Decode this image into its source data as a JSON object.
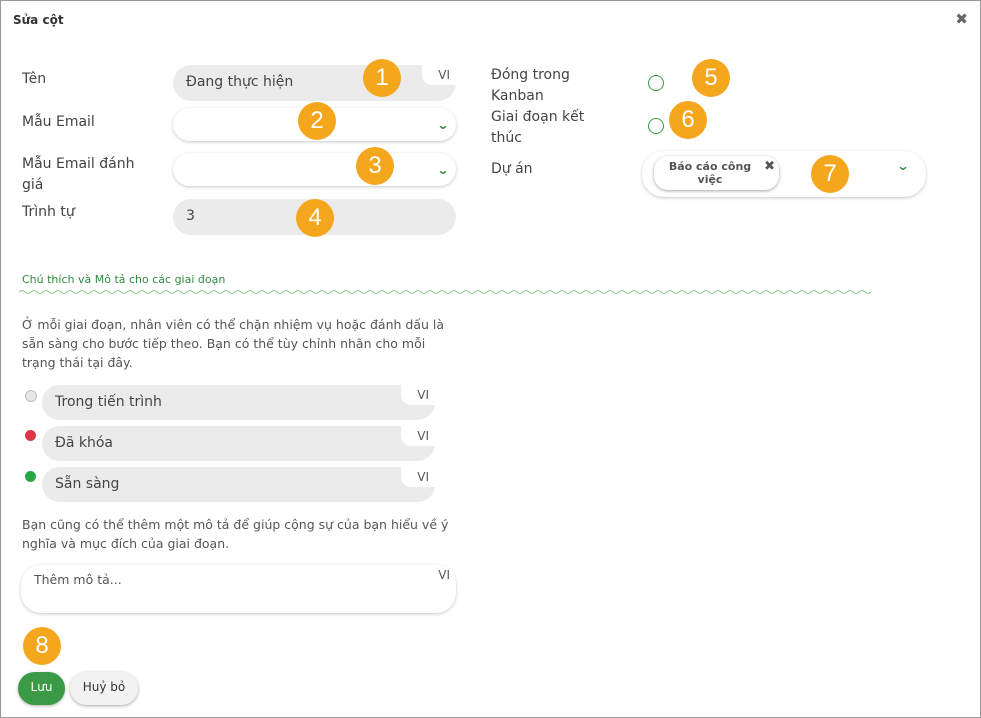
{
  "dialog": {
    "title": "Sửa cột",
    "close_glyph": "✖"
  },
  "form": {
    "name": {
      "label": "Tên",
      "value": "Đang thực hiện",
      "lang": "VI"
    },
    "email_template": {
      "label": "Mẫu Email",
      "value": ""
    },
    "rating_email_template": {
      "label": "Mẫu Email đánh giá",
      "value": ""
    },
    "sequence": {
      "label": "Trình tự",
      "value": "3"
    },
    "fold_in_kanban": {
      "label": "Đóng trong Kanban"
    },
    "final_stage": {
      "label": "Giai đoạn kết thúc"
    },
    "project": {
      "label": "Dự án",
      "tag": "Báo cáo công việc",
      "tag_remove": "✖"
    }
  },
  "badges": [
    "1",
    "2",
    "3",
    "4",
    "5",
    "6",
    "7",
    "8"
  ],
  "legend_section": {
    "title": "Chú thích và Mô tả cho các giai đoạn",
    "intro": "Ở mỗi giai đoạn, nhân viên có thể chặn nhiệm vụ hoặc đánh dấu là sẵn sàng cho bước tiếp theo. Bạn có thể tùy chỉnh nhãn cho mỗi trạng thái tại đây.",
    "states": [
      {
        "label": "Trong tiến trình",
        "lang": "VI",
        "color": "#d9d9d9"
      },
      {
        "label": "Đã khóa",
        "lang": "VI",
        "color": "#dc3545"
      },
      {
        "label": "Sẵn sàng",
        "lang": "VI",
        "color": "#28a745"
      }
    ],
    "description_hint": "Bạn cũng có thể thêm một mô tả để giúp cộng sự của bạn hiểu về ý nghĩa và mục đích của giai đoạn.",
    "description_placeholder": "Thêm mô tả...",
    "description_lang": "VI"
  },
  "footer": {
    "save_label": "Lưu",
    "cancel_label": "Huỷ bỏ"
  },
  "colors": {
    "accent_green": "#2e8b3e",
    "badge_orange": "#f4a71c"
  }
}
